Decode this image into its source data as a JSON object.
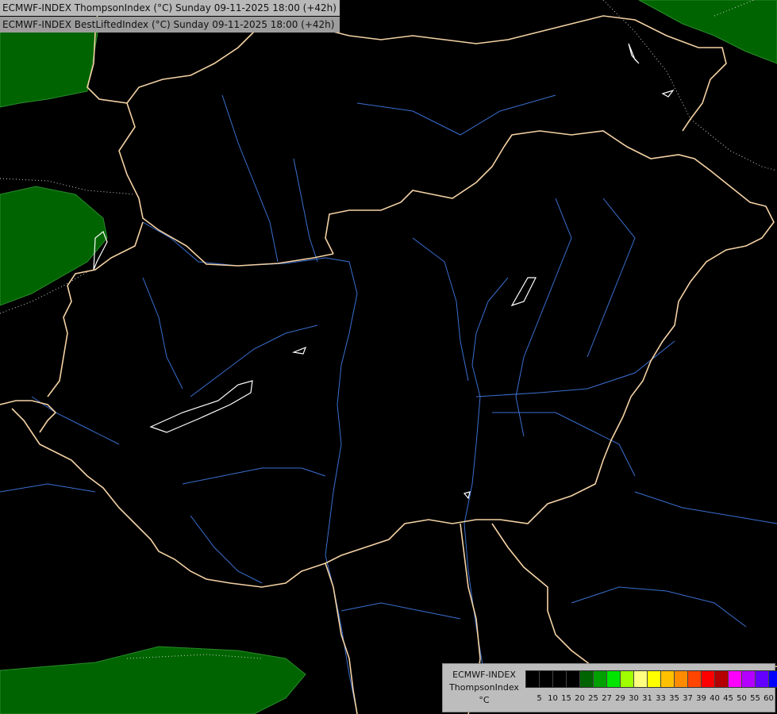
{
  "header": {
    "line1": "ECMWF-INDEX ThompsonIndex (°C) Sunday 09-11-2025 18:00 (+42h)",
    "line2": "ECMWF-INDEX BestLiftedIndex (°C) Sunday 09-11-2025 18:00 (+42h)"
  },
  "legend": {
    "title_line1": "ECMWF-INDEX",
    "title_line2": "ThompsonIndex",
    "unit": "°C",
    "scale": [
      {
        "label": "5",
        "color": "#000000"
      },
      {
        "label": "10",
        "color": "#000000"
      },
      {
        "label": "15",
        "color": "#000000"
      },
      {
        "label": "20",
        "color": "#000000"
      },
      {
        "label": "25",
        "color": "#006400"
      },
      {
        "label": "27",
        "color": "#00a000"
      },
      {
        "label": "29",
        "color": "#00e600"
      },
      {
        "label": "30",
        "color": "#a0ff00"
      },
      {
        "label": "31",
        "color": "#ffff80"
      },
      {
        "label": "33",
        "color": "#ffff00"
      },
      {
        "label": "35",
        "color": "#ffc000"
      },
      {
        "label": "37",
        "color": "#ff8c00"
      },
      {
        "label": "39",
        "color": "#ff4500"
      },
      {
        "label": "40",
        "color": "#ff0000"
      },
      {
        "label": "45",
        "color": "#b40000"
      },
      {
        "label": "50",
        "color": "#ff00ff"
      },
      {
        "label": "55",
        "color": "#b400ff"
      },
      {
        "label": "60",
        "color": "#6400ff"
      }
    ],
    "extra_tick": "60",
    "last_color": "#0000ff"
  },
  "map": {
    "background_color": "#000000",
    "index_fill_color": "#006400",
    "border_color": "#f4d2a4",
    "river_color": "#3a6fd0",
    "lake_outline_color": "#ffffff"
  }
}
